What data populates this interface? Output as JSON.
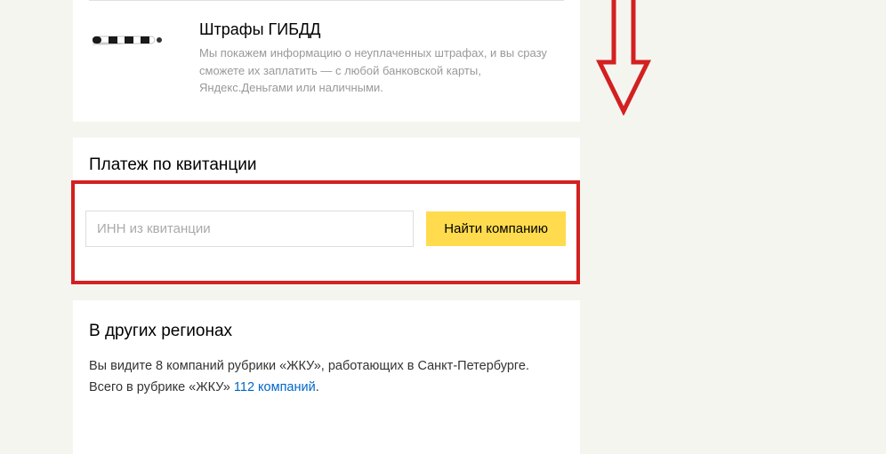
{
  "fines": {
    "title": "Штрафы ГИБДД",
    "description": "Мы покажем информацию о неуплаченных штрафах, и вы сразу сможете их заплатить — с любой банковской карты, Яндекс.Деньгами или наличными."
  },
  "payment": {
    "title": "Платеж по квитанции",
    "input_placeholder": "ИНН из квитанции",
    "button_label": "Найти компанию"
  },
  "regions": {
    "title": "В других регионах",
    "line1_prefix": "Вы видите 8 компаний рубрики «ЖКУ», работающих в Санкт-Петербурге.",
    "line2_prefix": "Всего в рубрике «ЖКУ» ",
    "link_text": "112 компаний",
    "period": "."
  }
}
